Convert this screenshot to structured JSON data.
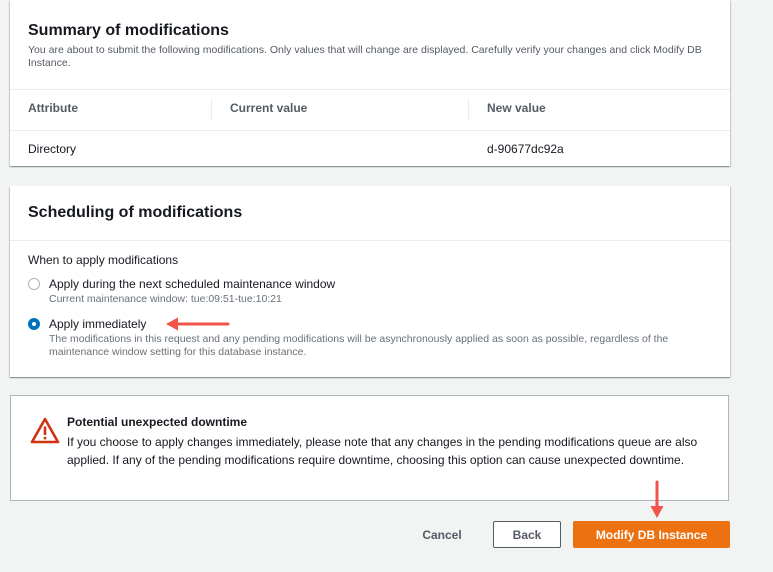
{
  "summary": {
    "title": "Summary of modifications",
    "description": "You are about to submit the following modifications. Only values that will change are displayed. Carefully verify your changes and click Modify DB Instance.",
    "columns": [
      "Attribute",
      "Current value",
      "New value"
    ],
    "rows": [
      {
        "attribute": "Directory",
        "current": "",
        "new": "d-90677dc92a"
      }
    ]
  },
  "scheduling": {
    "title": "Scheduling of modifications",
    "when_label": "When to apply modifications",
    "options": [
      {
        "label": "Apply during the next scheduled maintenance window",
        "description": "Current maintenance window: tue:09:51-tue:10:21",
        "selected": false
      },
      {
        "label": "Apply immediately",
        "description": "The modifications in this request and any pending modifications will be asynchronously applied as soon as possible, regardless of the maintenance window setting for this database instance.",
        "selected": true
      }
    ]
  },
  "alert": {
    "icon": "warning-icon",
    "title": "Potential unexpected downtime",
    "body": "If you choose to apply changes immediately, please note that any changes in the pending modifications queue are also applied. If any of the pending modifications require downtime, choosing this option can cause unexpected downtime."
  },
  "actions": {
    "cancel": "Cancel",
    "back": "Back",
    "submit": "Modify DB Instance"
  },
  "colors": {
    "primary_button": "#ec7211",
    "radio_selected": "#0073bb",
    "annotation_arrow": "#f0544a",
    "warning_icon": "#d13212"
  }
}
